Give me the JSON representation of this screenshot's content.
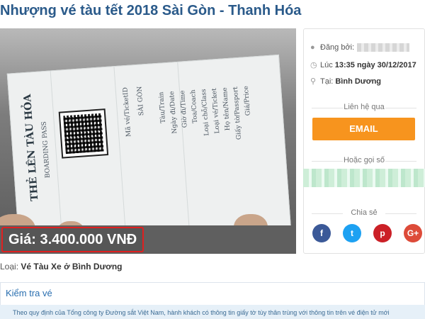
{
  "page": {
    "title": "Nhượng vé tàu tết 2018 Sài Gòn - Thanh Hóa"
  },
  "photo": {
    "ticket_title": "THẺ LÊN TÀU HỎA",
    "ticket_subtitle": "BOARDING PASS",
    "price_label": "Giá: 3.400.000 VNĐ"
  },
  "listing": {
    "category_prefix": "Loại:",
    "category_value": "Vé Tàu Xe ở Bình Dương"
  },
  "check": {
    "title": "Kiểm tra vé",
    "note": "Theo quy định của Tổng công ty Đường sắt Việt Nam, hành khách có thông tin giấy tờ tùy thân trùng với thông tin trên vé điện tử mới"
  },
  "sidebar": {
    "posted_by_label": "Đăng bởi:",
    "time_label": "Lúc",
    "time_value": "13:35 ngày 30/12/2017",
    "location_label": "Tại:",
    "location_value": "Bình Dương",
    "contact_heading": "Liên hệ qua",
    "email_label": "EMAIL",
    "call_heading": "Hoặc gọi số",
    "share_heading": "Chia sẻ",
    "share_buttons": [
      {
        "label": "f",
        "color": "#3b5998",
        "name": "facebook-share-button"
      },
      {
        "label": "t",
        "color": "#1da1f2",
        "name": "twitter-share-button"
      },
      {
        "label": "p",
        "color": "#cb2027",
        "name": "pinterest-share-button"
      },
      {
        "label": "G+",
        "color": "#dd4b39",
        "name": "google-plus-share-button"
      }
    ]
  },
  "colors": {
    "accent": "#f7941e",
    "title": "#2a5a8a",
    "price_border": "#e02020"
  }
}
